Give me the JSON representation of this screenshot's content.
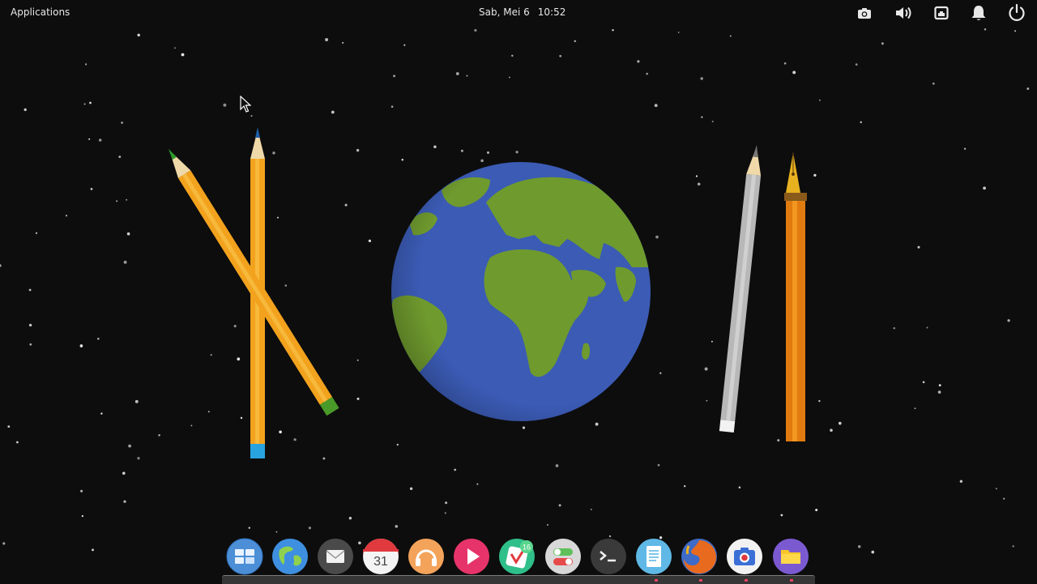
{
  "panel": {
    "applications_label": "Applications",
    "clock": {
      "date": "Sab, Mei 6",
      "time": "10:52"
    },
    "indicators": [
      {
        "icon": "screenshot-camera-icon"
      },
      {
        "icon": "volume-icon"
      },
      {
        "icon": "network-icon"
      },
      {
        "icon": "notifications-bell-icon"
      },
      {
        "icon": "power-icon"
      }
    ]
  },
  "dock": {
    "items": [
      {
        "name": "multitasking-view",
        "icon": "multitasking-icon"
      },
      {
        "name": "web-browser",
        "icon": "globe-icon"
      },
      {
        "name": "mail",
        "icon": "mail-icon"
      },
      {
        "name": "calendar",
        "icon": "calendar-icon",
        "day": "31"
      },
      {
        "name": "music",
        "icon": "headphones-icon"
      },
      {
        "name": "videos",
        "icon": "play-icon"
      },
      {
        "name": "appcenter",
        "icon": "appcenter-icon",
        "badge": "16"
      },
      {
        "name": "system-settings",
        "icon": "toggles-icon"
      },
      {
        "name": "terminal",
        "icon": "terminal-icon"
      },
      {
        "name": "text-editor",
        "icon": "document-icon"
      },
      {
        "name": "firefox",
        "icon": "firefox-icon"
      },
      {
        "name": "screenshot",
        "icon": "camera-icon"
      },
      {
        "name": "files",
        "icon": "folder-icon"
      }
    ]
  },
  "colors": {
    "background": "#0d0d0d",
    "ocean": "#3b5bb5",
    "land": "#6f9a2e",
    "pencil_yellow": "#f2a21d",
    "pen_orange": "#e07b10",
    "pencil_gray": "#b8b8b8",
    "notification_red": "#ff4466"
  }
}
